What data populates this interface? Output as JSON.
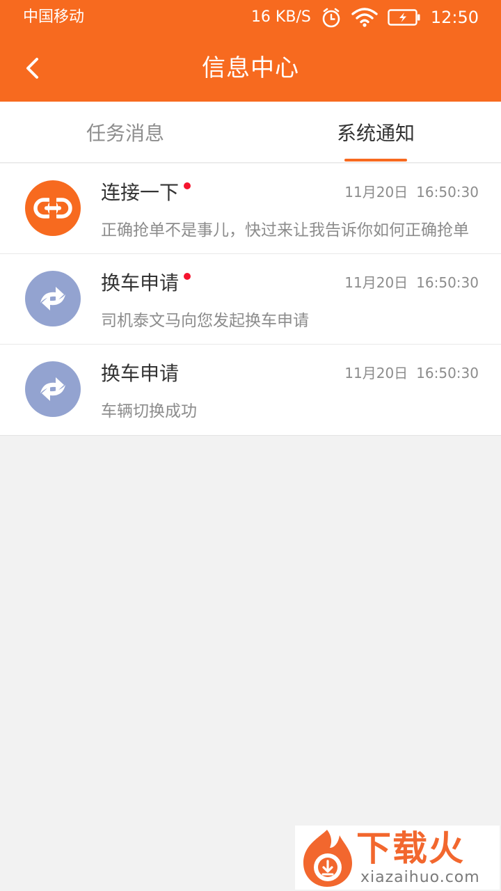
{
  "status_bar": {
    "carrier": "中国移动",
    "net_speed": "16 KB/S",
    "time": "12:50"
  },
  "header": {
    "title": "信息中心",
    "back_icon": "chevron-left-icon"
  },
  "tabs": [
    {
      "label": "任务消息",
      "active": false
    },
    {
      "label": "系统通知",
      "active": true
    }
  ],
  "messages": [
    {
      "title": "连接一下",
      "unread": true,
      "date": "11月20日",
      "time": "16:50:30",
      "preview": "正确抢单不是事儿，快过来让我告诉你如何正确抢单",
      "icon": "link-icon",
      "icon_color": "#f76a1f"
    },
    {
      "title": "换车申请",
      "unread": true,
      "date": "11月20日",
      "time": "16:50:30",
      "preview": "司机泰文马向您发起换车申请",
      "icon": "swap-icon",
      "icon_color": "#93a3d0"
    },
    {
      "title": "换车申请",
      "unread": false,
      "date": "11月20日",
      "time": "16:50:30",
      "preview": "车辆切换成功",
      "icon": "swap-icon",
      "icon_color": "#93a3d0"
    }
  ],
  "watermark": {
    "brand": "下载火",
    "url": "xiazaihuo.com"
  },
  "colors": {
    "accent": "#f76a1f",
    "unread_dot": "#f5142e",
    "background": "#f2f2f2"
  }
}
